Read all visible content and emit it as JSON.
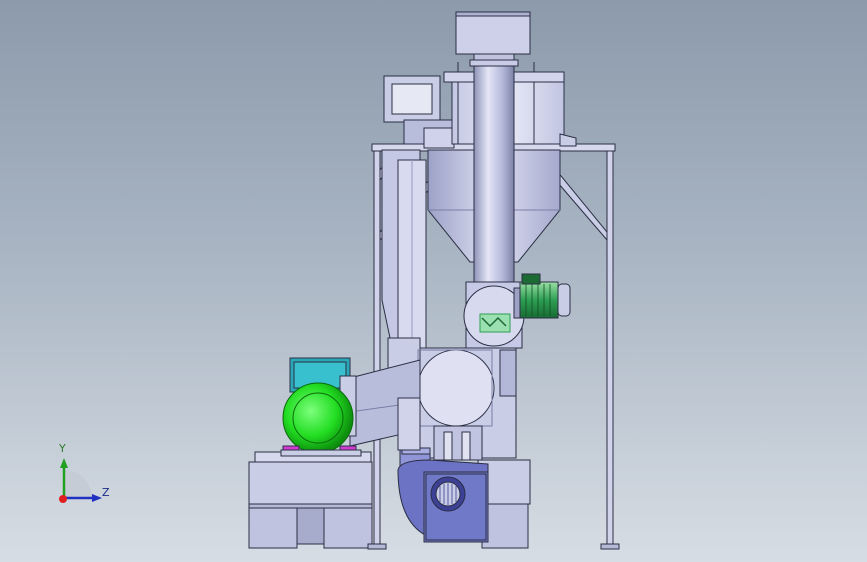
{
  "axis_triad": {
    "y_label": "Y",
    "z_label": "Z"
  },
  "colors": {
    "background_top": "#8c9aab",
    "background_bottom": "#d7dde4",
    "frame_metal": "#c9cde6",
    "frame_edge": "#2b2f44",
    "motor_green": "#22dd22",
    "motor_housing": "#2aa8b8",
    "fan_blue": "#6c73c4",
    "accent_green": "#2e9e52",
    "pad_magenta": "#d23bd2",
    "triad_red": "#e02020",
    "triad_green": "#22a022",
    "triad_blue": "#2030c0"
  },
  "icons": [
    "coordinate-triad-icon"
  ]
}
